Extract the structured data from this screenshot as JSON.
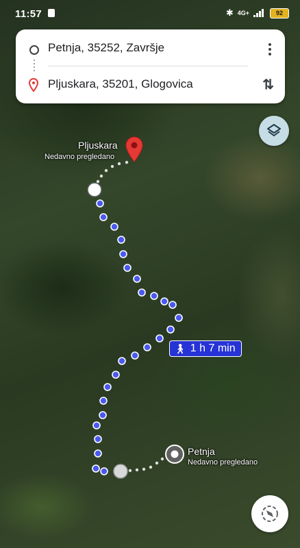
{
  "status_bar": {
    "time": "11:57",
    "network": "4G+",
    "battery": "92",
    "icons": [
      "notification-icon",
      "bluetooth-icon",
      "signal-icon",
      "battery-icon"
    ]
  },
  "directions": {
    "start": "Petnja, 35252, Završje",
    "destination": "Pljuskara, 35201, Glogovica",
    "icons": [
      "start-circle-icon",
      "destination-pin-icon",
      "more-options-icon",
      "swap-icon"
    ]
  },
  "map": {
    "destination_label": "Pljuskara",
    "destination_sub": "Nedavno pregledano",
    "start_label": "Petnja",
    "start_sub": "Nedavno pregledano",
    "duration": "1 h 7 min",
    "travel_mode_icon": "walk-icon",
    "route_color": "#4a5af0",
    "pin_color": "#e53935"
  },
  "controls": {
    "layers_icon": "layers-icon",
    "compass_icon": "compass-icon"
  }
}
